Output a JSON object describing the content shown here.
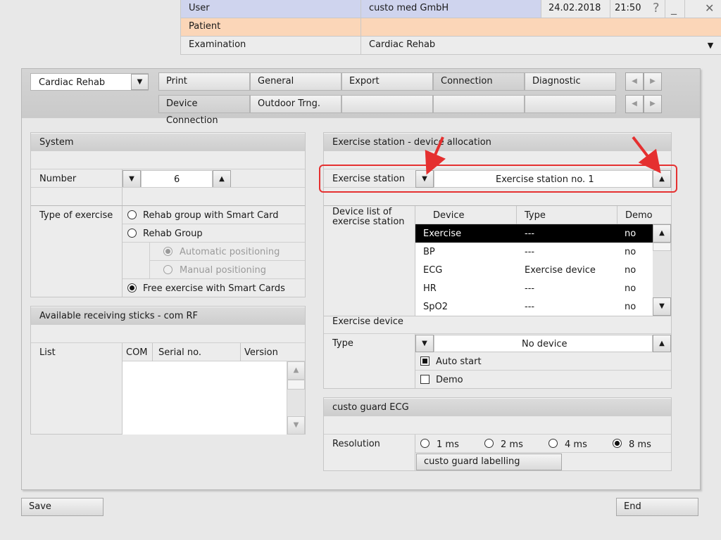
{
  "header": {
    "user_label": "User",
    "user_value": "custo med GmbH",
    "date": "24.02.2018",
    "time": "21:50",
    "help": "?",
    "minimize": "_",
    "close": "✕",
    "patient_label": "Patient",
    "patient_value": "",
    "examination_label": "Examination",
    "examination_value": "Cardiac Rehab"
  },
  "module_select": "Cardiac Rehab",
  "tabs_row1": [
    "Print",
    "General",
    "Export",
    "Connection",
    "Diagnostic"
  ],
  "tabs_row2": [
    "Device Connection",
    "Outdoor Trng."
  ],
  "system": {
    "title": "System",
    "number_label": "Number",
    "number_value": "6",
    "type_label": "Type of exercise",
    "options": [
      "Rehab group with Smart Card",
      "Rehab Group",
      "Automatic positioning",
      "Manual positioning",
      "Free exercise with Smart Cards"
    ]
  },
  "sticks": {
    "title": "Available receiving sticks - com RF",
    "list_label": "List",
    "columns": [
      "COM",
      "Serial no.",
      "Version"
    ]
  },
  "allocation": {
    "title": "Exercise station - device allocation",
    "station_label": "Exercise station",
    "station_value": "Exercise station no. 1",
    "device_list_label": "Device list of exercise station",
    "columns": [
      "Device",
      "Type",
      "Demo"
    ],
    "rows": [
      {
        "device": "Exercise",
        "type": "---",
        "demo": "no"
      },
      {
        "device": "BP",
        "type": "---",
        "demo": "no"
      },
      {
        "device": "ECG",
        "type": "Exercise device",
        "demo": "no"
      },
      {
        "device": "HR",
        "type": "---",
        "demo": "no"
      },
      {
        "device": "SpO2",
        "type": "---",
        "demo": "no"
      }
    ],
    "exercise_device_label": "Exercise device",
    "type_label": "Type",
    "type_value": "No device",
    "auto_start": "Auto start",
    "demo": "Demo"
  },
  "guard": {
    "title": "custo guard ECG",
    "resolution_label": "Resolution",
    "options": [
      "1 ms",
      "2 ms",
      "4 ms",
      "8 ms"
    ],
    "labelling_button": "custo guard labelling"
  },
  "footer": {
    "save": "Save",
    "end": "End"
  },
  "colors": {
    "patient_bg": "#fbd6b8",
    "user_bg": "#cfd4ee",
    "annotation": "#e53030",
    "selected_row": "#000000"
  }
}
